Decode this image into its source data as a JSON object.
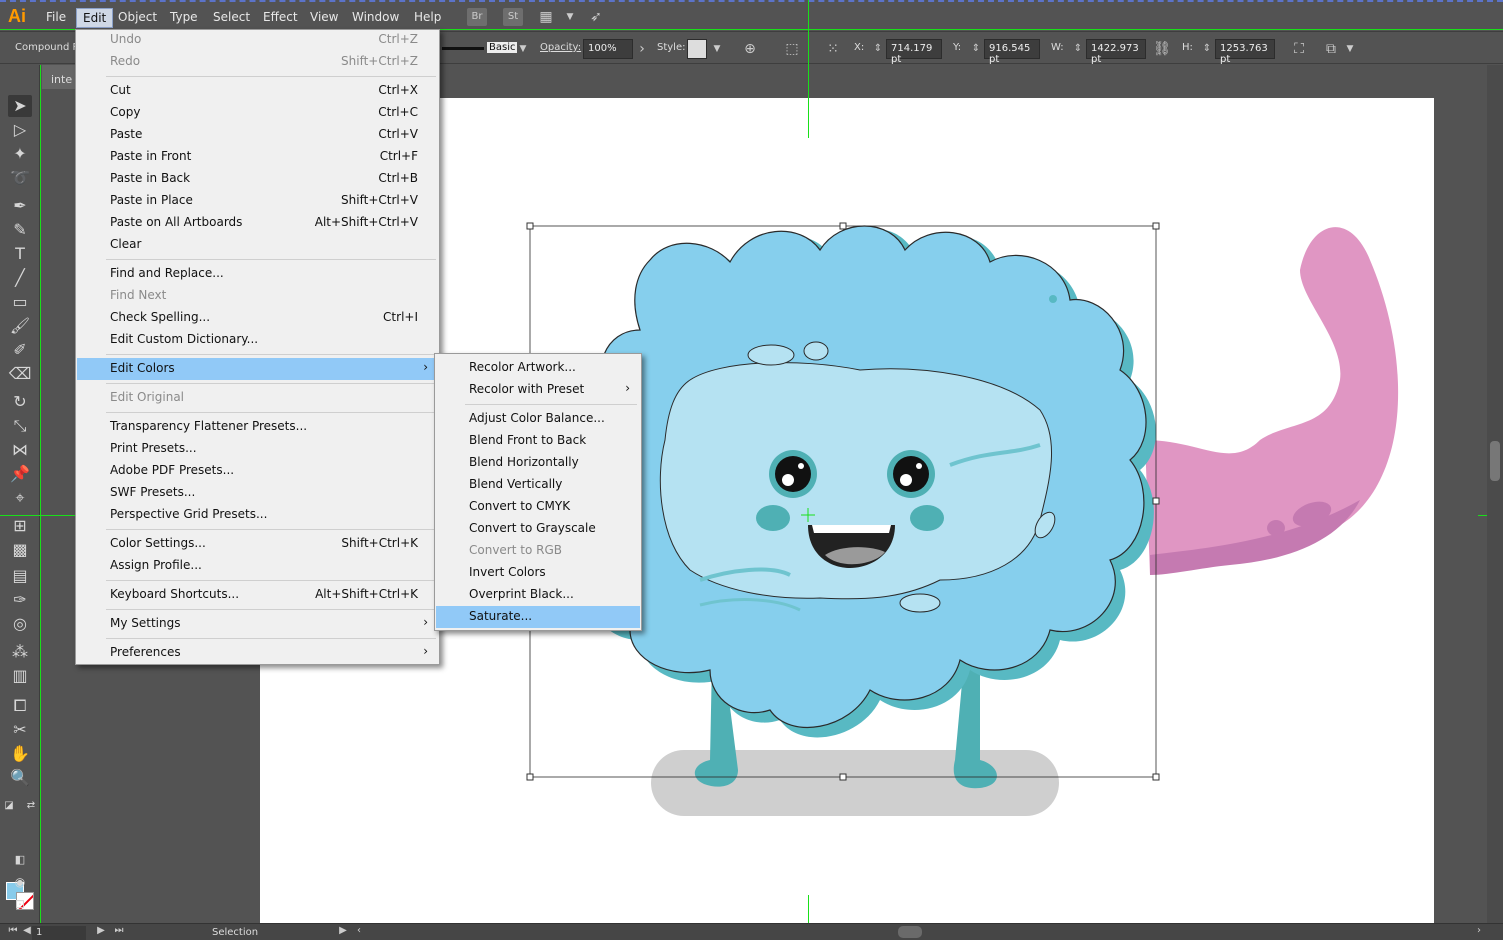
{
  "app": {
    "logo": "Ai"
  },
  "menubar": {
    "items": [
      "File",
      "Edit",
      "Object",
      "Type",
      "Select",
      "Effect",
      "View",
      "Window",
      "Help"
    ],
    "icons": [
      "Br",
      "St"
    ]
  },
  "controlbar": {
    "object_type": "Compound Pa",
    "stroke_style": "Basic",
    "opacity_label": "Opacity:",
    "opacity_value": "100%",
    "style_label": "Style:",
    "x_label": "X:",
    "x_value": "714.179 pt",
    "y_label": "Y:",
    "y_value": "916.545 pt",
    "w_label": "W:",
    "w_value": "1422.973 pt",
    "h_label": "H:",
    "h_value": "1253.763 pt"
  },
  "document_tab": {
    "label": "inte"
  },
  "edit_menu": {
    "items": [
      {
        "label": "Undo",
        "shortcut": "Ctrl+Z"
      },
      {
        "label": "Redo",
        "shortcut": "Shift+Ctrl+Z"
      },
      {
        "label": "Cut",
        "shortcut": "Ctrl+X"
      },
      {
        "label": "Copy",
        "shortcut": "Ctrl+C"
      },
      {
        "label": "Paste",
        "shortcut": "Ctrl+V"
      },
      {
        "label": "Paste in Front",
        "shortcut": "Ctrl+F"
      },
      {
        "label": "Paste in Back",
        "shortcut": "Ctrl+B"
      },
      {
        "label": "Paste in Place",
        "shortcut": "Shift+Ctrl+V"
      },
      {
        "label": "Paste on All Artboards",
        "shortcut": "Alt+Shift+Ctrl+V"
      },
      {
        "label": "Clear",
        "shortcut": ""
      },
      {
        "label": "Find and Replace...",
        "shortcut": ""
      },
      {
        "label": "Find Next",
        "shortcut": ""
      },
      {
        "label": "Check Spelling...",
        "shortcut": "Ctrl+I"
      },
      {
        "label": "Edit Custom Dictionary...",
        "shortcut": ""
      },
      {
        "label": "Edit Colors",
        "shortcut": ""
      },
      {
        "label": "Edit Original",
        "shortcut": ""
      },
      {
        "label": "Transparency Flattener Presets...",
        "shortcut": ""
      },
      {
        "label": "Print Presets...",
        "shortcut": ""
      },
      {
        "label": "Adobe PDF Presets...",
        "shortcut": ""
      },
      {
        "label": "SWF Presets...",
        "shortcut": ""
      },
      {
        "label": "Perspective Grid Presets...",
        "shortcut": ""
      },
      {
        "label": "Color Settings...",
        "shortcut": "Shift+Ctrl+K"
      },
      {
        "label": "Assign Profile...",
        "shortcut": ""
      },
      {
        "label": "Keyboard Shortcuts...",
        "shortcut": "Alt+Shift+Ctrl+K"
      },
      {
        "label": "My Settings",
        "shortcut": ""
      },
      {
        "label": "Preferences",
        "shortcut": ""
      }
    ]
  },
  "edit_colors_submenu": {
    "items": [
      {
        "label": "Recolor Artwork..."
      },
      {
        "label": "Recolor with Preset"
      },
      {
        "label": "Adjust Color Balance..."
      },
      {
        "label": "Blend Front to Back"
      },
      {
        "label": "Blend Horizontally"
      },
      {
        "label": "Blend Vertically"
      },
      {
        "label": "Convert to CMYK"
      },
      {
        "label": "Convert to Grayscale"
      },
      {
        "label": "Convert to RGB"
      },
      {
        "label": "Invert Colors"
      },
      {
        "label": "Overprint Black..."
      },
      {
        "label": "Saturate..."
      }
    ]
  },
  "statusbar": {
    "artboard_number": "1",
    "tool_name": "Selection"
  },
  "colors": {
    "fill": "#88cbea",
    "menu_highlight": "#91c9f7",
    "guide": "#19e019"
  }
}
